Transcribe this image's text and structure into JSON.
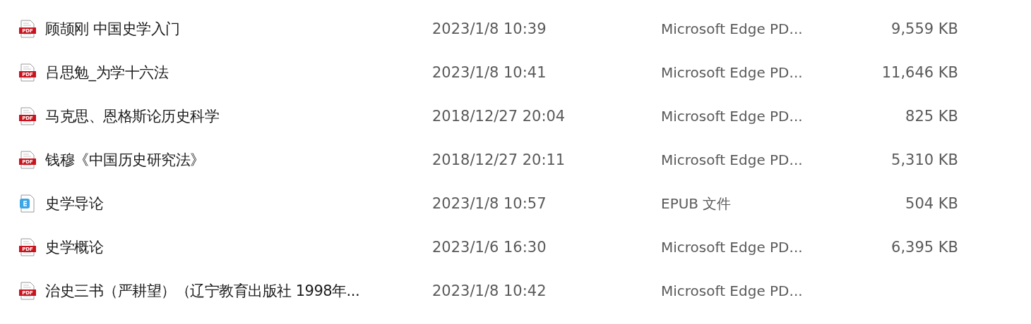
{
  "files": [
    {
      "kind": "pdf",
      "badge": "PDF",
      "name": "顾颉刚 中国史学入门",
      "modified": "2023/1/8 10:39",
      "type": "Microsoft Edge PD...",
      "size": "9,559 KB"
    },
    {
      "kind": "pdf",
      "badge": "PDF",
      "name": "吕思勉_为学十六法",
      "modified": "2023/1/8 10:41",
      "type": "Microsoft Edge PD...",
      "size": "11,646 KB"
    },
    {
      "kind": "pdf",
      "badge": "PDF",
      "name": "马克思、恩格斯论历史科学",
      "modified": "2018/12/27 20:04",
      "type": "Microsoft Edge PD...",
      "size": "825 KB"
    },
    {
      "kind": "pdf",
      "badge": "PDF",
      "name": "钱穆《中国历史研究法》",
      "modified": "2018/12/27 20:11",
      "type": "Microsoft Edge PD...",
      "size": "5,310 KB"
    },
    {
      "kind": "epub",
      "name": "史学导论",
      "modified": "2023/1/8 10:57",
      "type": "EPUB 文件",
      "size": "504 KB"
    },
    {
      "kind": "pdf",
      "badge": "PDF",
      "name": "史学概论",
      "modified": "2023/1/6 16:30",
      "type": "Microsoft Edge PD...",
      "size": "6,395 KB"
    },
    {
      "kind": "pdf",
      "badge": "PDF",
      "name": "治史三书（严耕望）（辽宁教育出版社 1998年...",
      "modified": "2023/1/8 10:42",
      "type": "Microsoft Edge PD..."
    }
  ]
}
